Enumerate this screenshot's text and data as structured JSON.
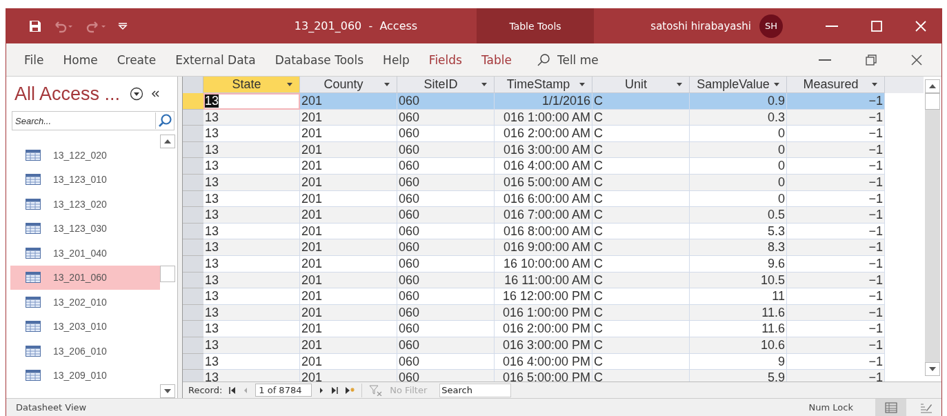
{
  "window": {
    "title": "13_201_060  -  Access",
    "context_label": "Table Tools",
    "user": "satoshi hirabayashi",
    "avatar": "SH"
  },
  "ribbon_tabs": [
    {
      "label": "File",
      "kind": "normal"
    },
    {
      "label": "Home",
      "kind": "normal"
    },
    {
      "label": "Create",
      "kind": "normal"
    },
    {
      "label": "External Data",
      "kind": "normal"
    },
    {
      "label": "Database Tools",
      "kind": "normal"
    },
    {
      "label": "Help",
      "kind": "normal"
    },
    {
      "label": "Fields",
      "kind": "context"
    },
    {
      "label": "Table",
      "kind": "context"
    }
  ],
  "tell_me": {
    "placeholder": "Tell me"
  },
  "navigation": {
    "title": "All Access ...",
    "search": {
      "placeholder": "Search..."
    },
    "items": [
      {
        "label": "13_122_020",
        "selected": false
      },
      {
        "label": "13_123_010",
        "selected": false
      },
      {
        "label": "13_123_020",
        "selected": false
      },
      {
        "label": "13_123_030",
        "selected": false
      },
      {
        "label": "13_201_040",
        "selected": false
      },
      {
        "label": "13_201_060",
        "selected": true
      },
      {
        "label": "13_202_010",
        "selected": false
      },
      {
        "label": "13_203_010",
        "selected": false
      },
      {
        "label": "13_206_010",
        "selected": false
      },
      {
        "label": "13_209_010",
        "selected": false
      }
    ]
  },
  "table": {
    "columns": [
      {
        "label": "State",
        "selected": true
      },
      {
        "label": "County",
        "selected": false
      },
      {
        "label": "SiteID",
        "selected": false
      },
      {
        "label": "TimeStamp",
        "selected": false
      },
      {
        "label": "Unit",
        "selected": false
      },
      {
        "label": "SampleValue",
        "selected": false
      },
      {
        "label": "Measured",
        "selected": false
      }
    ],
    "rows": [
      {
        "cells": [
          "13",
          "201",
          "060",
          "1/1/2016",
          "C",
          "0.9",
          "−1"
        ],
        "selected": true
      },
      {
        "cells": [
          "13",
          "201",
          "060",
          "016 1:00:00 AM",
          "C",
          "0.3",
          "−1"
        ],
        "selected": false
      },
      {
        "cells": [
          "13",
          "201",
          "060",
          "016 2:00:00 AM",
          "C",
          "0",
          "−1"
        ],
        "selected": false
      },
      {
        "cells": [
          "13",
          "201",
          "060",
          "016 3:00:00 AM",
          "C",
          "0",
          "−1"
        ],
        "selected": false
      },
      {
        "cells": [
          "13",
          "201",
          "060",
          "016 4:00:00 AM",
          "C",
          "0",
          "−1"
        ],
        "selected": false
      },
      {
        "cells": [
          "13",
          "201",
          "060",
          "016 5:00:00 AM",
          "C",
          "0",
          "−1"
        ],
        "selected": false
      },
      {
        "cells": [
          "13",
          "201",
          "060",
          "016 6:00:00 AM",
          "C",
          "0",
          "−1"
        ],
        "selected": false
      },
      {
        "cells": [
          "13",
          "201",
          "060",
          "016 7:00:00 AM",
          "C",
          "0.5",
          "−1"
        ],
        "selected": false
      },
      {
        "cells": [
          "13",
          "201",
          "060",
          "016 8:00:00 AM",
          "C",
          "5.3",
          "−1"
        ],
        "selected": false
      },
      {
        "cells": [
          "13",
          "201",
          "060",
          "016 9:00:00 AM",
          "C",
          "8.3",
          "−1"
        ],
        "selected": false
      },
      {
        "cells": [
          "13",
          "201",
          "060",
          "16 10:00:00 AM",
          "C",
          "9.6",
          "−1"
        ],
        "selected": false
      },
      {
        "cells": [
          "13",
          "201",
          "060",
          "16 11:00:00 AM",
          "C",
          "10.5",
          "−1"
        ],
        "selected": false
      },
      {
        "cells": [
          "13",
          "201",
          "060",
          "16 12:00:00 PM",
          "C",
          "11",
          "−1"
        ],
        "selected": false
      },
      {
        "cells": [
          "13",
          "201",
          "060",
          "016 1:00:00 PM",
          "C",
          "11.6",
          "−1"
        ],
        "selected": false
      },
      {
        "cells": [
          "13",
          "201",
          "060",
          "016 2:00:00 PM",
          "C",
          "11.6",
          "−1"
        ],
        "selected": false
      },
      {
        "cells": [
          "13",
          "201",
          "060",
          "016 3:00:00 PM",
          "C",
          "10.6",
          "−1"
        ],
        "selected": false
      },
      {
        "cells": [
          "13",
          "201",
          "060",
          "016 4:00:00 PM",
          "C",
          "9",
          "−1"
        ],
        "selected": false
      },
      {
        "cells": [
          "13",
          "201",
          "060",
          "016 5:00:00 PM",
          "C",
          "5.9",
          "−1"
        ],
        "selected": false
      }
    ]
  },
  "record_nav": {
    "label": "Record:",
    "position": "1 of 8784",
    "filter": "No Filter",
    "filter_disabled": true,
    "search": {
      "placeholder": "Search"
    }
  },
  "status_bar": {
    "view": "Datasheet View",
    "num_lock": "Num Lock"
  }
}
